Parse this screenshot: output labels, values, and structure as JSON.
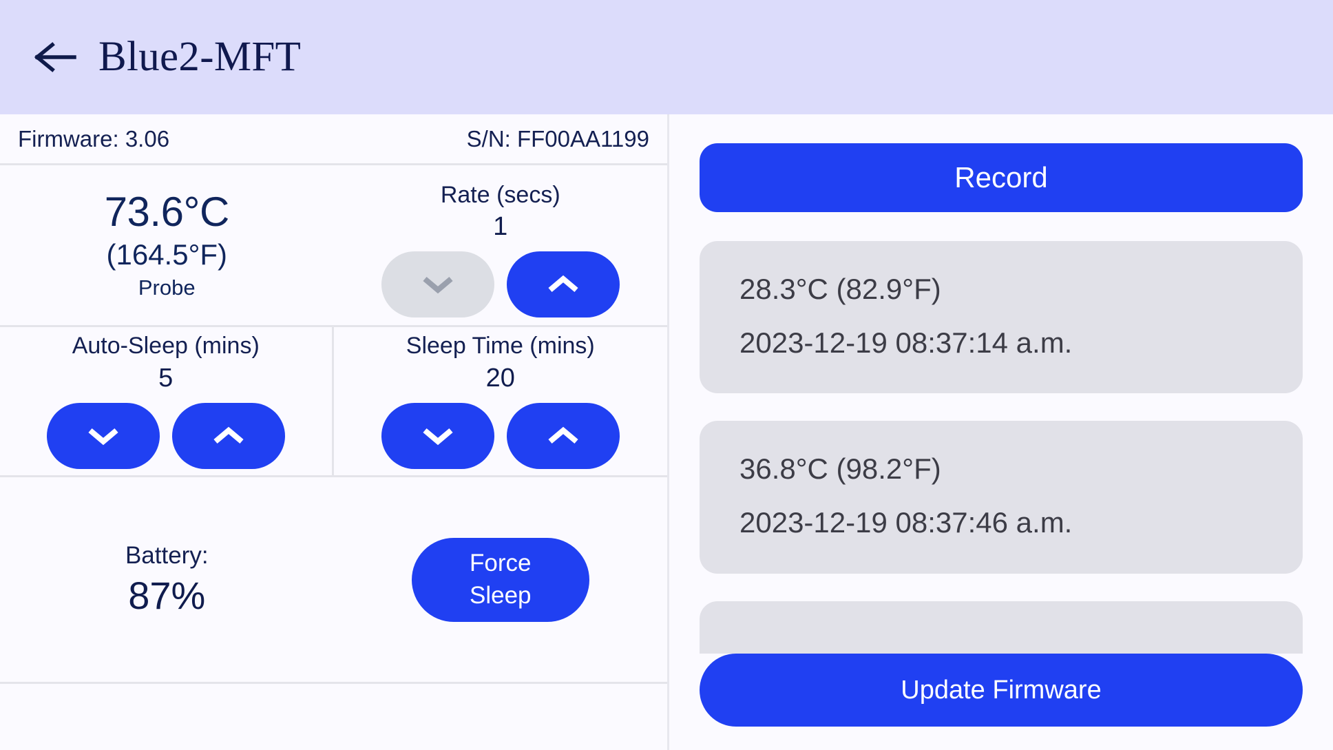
{
  "header": {
    "back_icon": "arrow-left-icon",
    "title": "Blue2-MFT",
    "background_color": "#dcdcfb",
    "title_color": "#10194e"
  },
  "device_info": {
    "firmware": "Firmware: 3.06",
    "serial": "S/N: FF00AA1199"
  },
  "reading": {
    "celsius": "73.6°C",
    "fahrenheit": "(164.5°F)",
    "source_label": "Probe"
  },
  "rate": {
    "title": "Rate (secs)",
    "value": "1",
    "decrement_icon": "chevron-down-icon",
    "increment_icon": "chevron-up-icon",
    "decrement_disabled": true
  },
  "auto_sleep": {
    "title": "Auto-Sleep (mins)",
    "value": "5",
    "decrement_icon": "chevron-down-icon",
    "increment_icon": "chevron-up-icon"
  },
  "sleep_time": {
    "title": "Sleep Time (mins)",
    "value": "20",
    "decrement_icon": "chevron-down-icon",
    "increment_icon": "chevron-up-icon"
  },
  "battery": {
    "label": "Battery:",
    "value": "87%"
  },
  "force_sleep": {
    "line1": "Force",
    "line2": "Sleep"
  },
  "actions": {
    "record_label": "Record",
    "update_firmware_label": "Update Firmware"
  },
  "records": [
    {
      "temperature": "28.3°C (82.9°F)",
      "timestamp": "2023-12-19 08:37:14 a.m."
    },
    {
      "temperature": "36.8°C (98.2°F)",
      "timestamp": "2023-12-19 08:37:46 a.m."
    },
    {
      "temperature": "",
      "timestamp": ""
    }
  ],
  "colors": {
    "accent_blue": "#2040f2",
    "disabled_gray": "#dcdee4",
    "card_gray": "#e1e1e8",
    "page_background": "#fbfaff",
    "text_navy": "#142052",
    "record_text": "#3c3c46"
  }
}
